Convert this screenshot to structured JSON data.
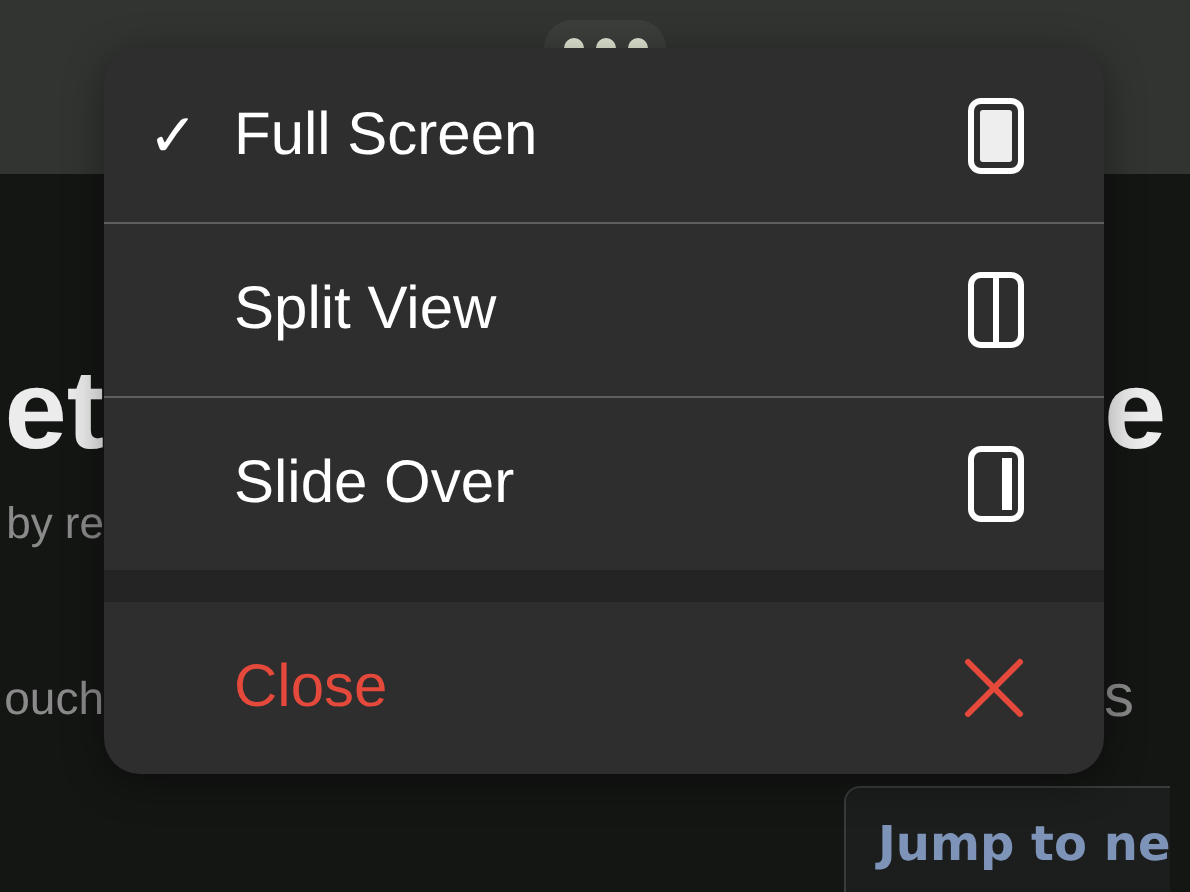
{
  "background": {
    "heading_start": "et",
    "heading_end": "e",
    "subtitle_start": "by re",
    "body_start": "ouch",
    "body_end": "s",
    "jump_button": "Jump to ne"
  },
  "menu": {
    "check_glyph": "✓",
    "items": [
      {
        "label": "Full Screen",
        "selected": true,
        "kind": "full"
      },
      {
        "label": "Split View",
        "selected": false,
        "kind": "split"
      },
      {
        "label": "Slide Over",
        "selected": false,
        "kind": "slide"
      }
    ],
    "close": {
      "label": "Close"
    }
  }
}
